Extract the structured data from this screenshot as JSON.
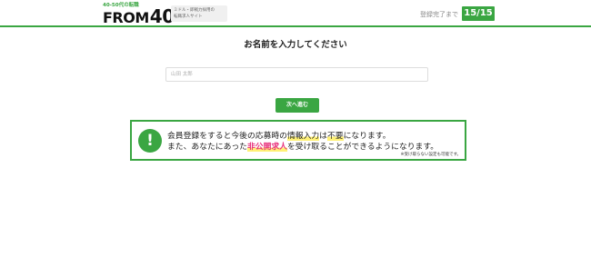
{
  "header": {
    "logo_tagline": "40-50代の転職",
    "logo_brand_text": "FROM",
    "logo_brand_num": "40",
    "logo_sub_line1": "ミドル・即戦力採用の",
    "logo_sub_line2": "転職求人サイト",
    "progress_label": "登録完了まで",
    "progress_value": "15/15"
  },
  "form": {
    "title": "お名前を入力してください",
    "name_placeholder": "山田 太郎",
    "name_value": "",
    "next_label": "次へ進む"
  },
  "notice": {
    "icon_glyph": "!",
    "line1_a": "会員登録をすると今後の応募時の",
    "line1_b": "情報入力",
    "line1_c": "は",
    "line1_d": "不要",
    "line1_e": "になります。",
    "line2_a": "また、あなたにあった",
    "line2_b": "非公開求人",
    "line2_c": "を受け取ることができるようになります。",
    "small_note": "※受け取らない設定も可能です。"
  },
  "colors": {
    "brand_green": "#3aa642",
    "highlight_yellow": "#fff176",
    "highlight_pink": "#e8327c"
  }
}
